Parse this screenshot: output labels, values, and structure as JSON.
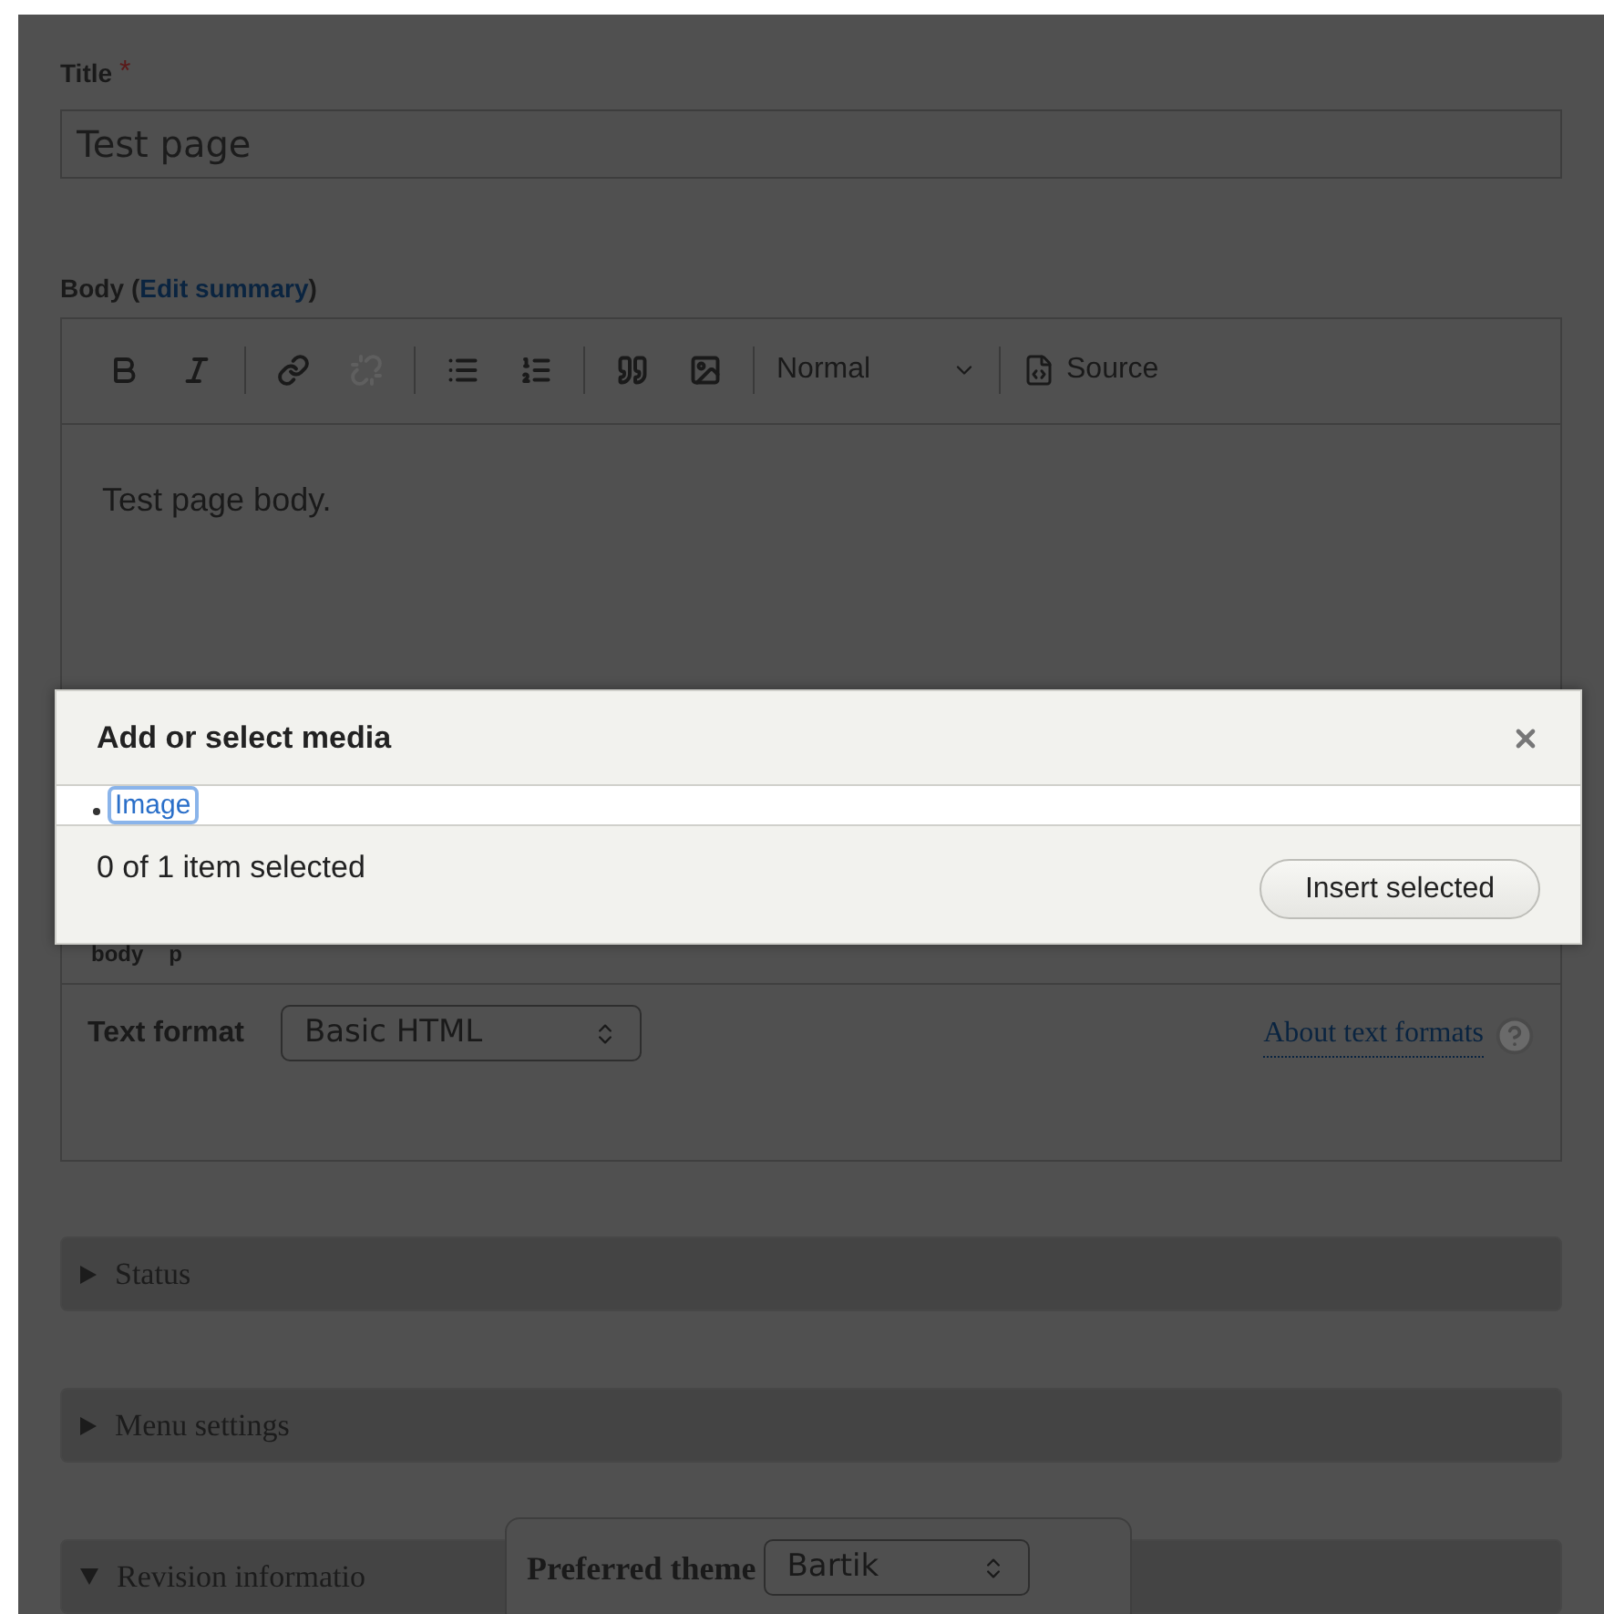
{
  "title_field": {
    "label": "Title",
    "required_mark": "*",
    "value": "Test page"
  },
  "body": {
    "label": "Body",
    "summary_open": "(",
    "summary_link": "Edit summary",
    "summary_close": ")",
    "toolbar": [
      {
        "kind": "bold",
        "disabled": false
      },
      {
        "kind": "italic",
        "disabled": false
      },
      {
        "kind": "divider"
      },
      {
        "kind": "link",
        "disabled": false
      },
      {
        "kind": "unlink",
        "disabled": true
      },
      {
        "kind": "divider"
      },
      {
        "kind": "bullets",
        "disabled": false
      },
      {
        "kind": "numbers",
        "disabled": false
      },
      {
        "kind": "divider"
      },
      {
        "kind": "quote",
        "disabled": false
      },
      {
        "kind": "media",
        "disabled": false
      },
      {
        "kind": "divider"
      }
    ],
    "format_dropdown": "Normal",
    "source_button": "Source",
    "content": "Test page body.",
    "path": [
      "body",
      "p"
    ]
  },
  "text_format": {
    "label": "Text format",
    "value": "Basic HTML",
    "help_link": "About text formats"
  },
  "sections": [
    {
      "label": "Status",
      "expanded": false
    },
    {
      "label": "Menu settings",
      "expanded": false
    },
    {
      "label": "Revision informatio",
      "expanded": true
    }
  ],
  "dialog": {
    "title": "Add or select media",
    "tabs": [
      {
        "label": "Image",
        "selected": true
      }
    ],
    "status": "0 of 1 item selected",
    "button": "Insert selected"
  },
  "theme_popup": {
    "label": "Preferred theme",
    "value": "Bartik"
  }
}
